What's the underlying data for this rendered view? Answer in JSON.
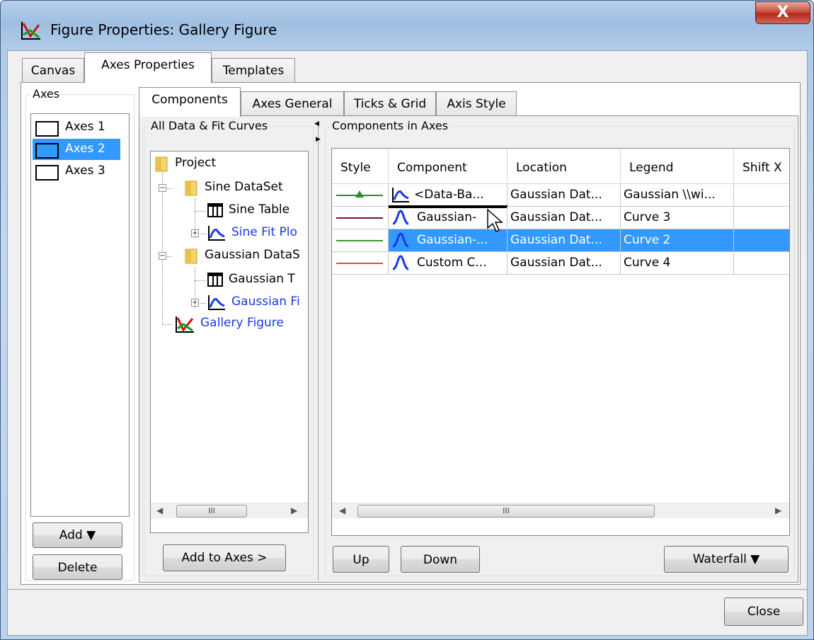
{
  "window": {
    "title": "Figure Properties: Gallery Figure",
    "close_glyph": "X"
  },
  "main_tabs": [
    {
      "label": "Canvas",
      "active": false
    },
    {
      "label": "Axes Properties",
      "active": true
    },
    {
      "label": "Templates",
      "active": false
    }
  ],
  "axes_panel": {
    "title": "Axes",
    "items": [
      {
        "label": "Axes 1",
        "selected": false
      },
      {
        "label": "Axes 2",
        "selected": true
      },
      {
        "label": "Axes 3",
        "selected": false
      }
    ],
    "add_label": "Add ▼",
    "delete_label": "Delete"
  },
  "sub_tabs": [
    {
      "label": "Components",
      "active": true
    },
    {
      "label": "Axes General",
      "active": false
    },
    {
      "label": "Ticks & Grid",
      "active": false
    },
    {
      "label": "Axis Style",
      "active": false
    }
  ],
  "tree_panel": {
    "title": "All Data & Fit Curves",
    "nodes": {
      "project": "Project",
      "sine_dataset": "Sine DataSet",
      "sine_table": "Sine Table",
      "sine_fit": "Sine Fit Plo",
      "gaussian_dataset": "Gaussian DataS",
      "gaussian_table": "Gaussian T",
      "gaussian_fit": "Gaussian Fi",
      "gallery_figure": "Gallery Figure"
    },
    "scroll_grip": "III",
    "add_to_axes_label": "Add to Axes >"
  },
  "components_panel": {
    "title": "Components in Axes",
    "columns": [
      "Style",
      "Component",
      "Location",
      "Legend",
      "Shift X"
    ],
    "rows": [
      {
        "style_color": "#2e8b2e",
        "marker": "triangle",
        "component": "<Data-Ba...",
        "location": "Gaussian Dat...",
        "legend": "Gaussian \\\\wi...",
        "selected": false
      },
      {
        "style_color": "#7a1030",
        "marker": "none",
        "component": "Gaussian-",
        "location": "Gaussian Dat...",
        "legend": "Curve 3",
        "selected": false
      },
      {
        "style_color": "#3a9a2a",
        "marker": "none",
        "component": "Gaussian-...",
        "location": "Gaussian Dat...",
        "legend": "Curve 2",
        "selected": true
      },
      {
        "style_color": "#e8501c",
        "marker": "none",
        "component": "Custom C...",
        "location": "Gaussian Dat...",
        "legend": "Curve 4",
        "selected": false
      }
    ],
    "scroll_grip": "III",
    "up_label": "Up",
    "down_label": "Down",
    "waterfall_label": "Waterfall ▼"
  },
  "footer": {
    "close_label": "Close"
  },
  "colors": {
    "selection": "#3399ff",
    "link_blue": "#1a38e8"
  }
}
